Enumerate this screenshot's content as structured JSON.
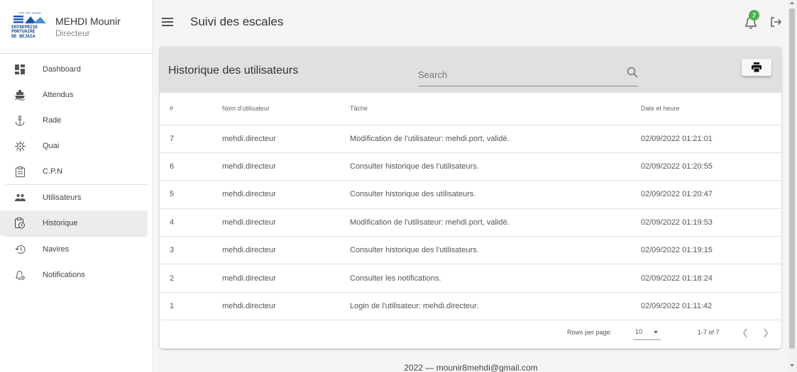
{
  "logo": {
    "arabic_text": "مؤسسة ميناء بجاية",
    "lines": [
      "ENTREPRISE",
      "PORTUAIRE",
      "DE BEJAIA"
    ]
  },
  "profile": {
    "name": "MEHDI Mounir",
    "role": "Directeur"
  },
  "sidebar": {
    "items": [
      {
        "label": "Dashboard",
        "icon": "dashboard-icon"
      },
      {
        "label": "Attendus",
        "icon": "ship-icon"
      },
      {
        "label": "Rade",
        "icon": "anchor-icon"
      },
      {
        "label": "Quai",
        "icon": "dock-icon"
      },
      {
        "label": "C.P.N",
        "icon": "clipboard-icon"
      },
      {
        "label": "Utilisateurs",
        "icon": "users-icon"
      },
      {
        "label": "Historique",
        "icon": "history-clipboard-icon"
      },
      {
        "label": "Navires",
        "icon": "restore-icon"
      },
      {
        "label": "Notifications",
        "icon": "bell-settings-icon"
      }
    ],
    "active": "Historique"
  },
  "header": {
    "title": "Suivi des escales",
    "notification_count": "7"
  },
  "card": {
    "title": "Historique des utilisateurs",
    "search_placeholder": "Search"
  },
  "table": {
    "columns": [
      "#",
      "Nom d'utilisateur",
      "Tâche",
      "Date et heure"
    ],
    "rows": [
      [
        "7",
        "mehdi.directeur",
        "Modification de l'utilisateur: mehdi.port, validé.",
        "02/09/2022 01:21:01"
      ],
      [
        "6",
        "mehdi.directeur",
        "Consulter historique des l'utilisateurs.",
        "02/09/2022 01:20:55"
      ],
      [
        "5",
        "mehdi.directeur",
        "Consulter historique des utilisateurs.",
        "02/09/2022 01:20:47"
      ],
      [
        "4",
        "mehdi.directeur",
        "Modification de l'utilisateur: mehdi.port, validé.",
        "02/09/2022 01:19:53"
      ],
      [
        "3",
        "mehdi.directeur",
        "Consulter historique des l'utilisateurs.",
        "02/09/2022 01:19:15"
      ],
      [
        "2",
        "mehdi.directeur",
        "Consulter les notifications.",
        "02/09/2022 01:18:24"
      ],
      [
        "1",
        "mehdi.directeur",
        "Login de l'utilisateur: mehdi.directeur.",
        "02/09/2022 01:11:42"
      ]
    ]
  },
  "pagination": {
    "rows_per_page_label": "Rows per page:",
    "rows_per_page_value": "10",
    "range": "1-7 of 7"
  },
  "footer": {
    "copyright": "2022 — mounir8mehdi@gmail.com"
  },
  "colors": {
    "badge": "#4caf50",
    "header_bg": "#e0e0e0",
    "active_item": "#ececec"
  }
}
